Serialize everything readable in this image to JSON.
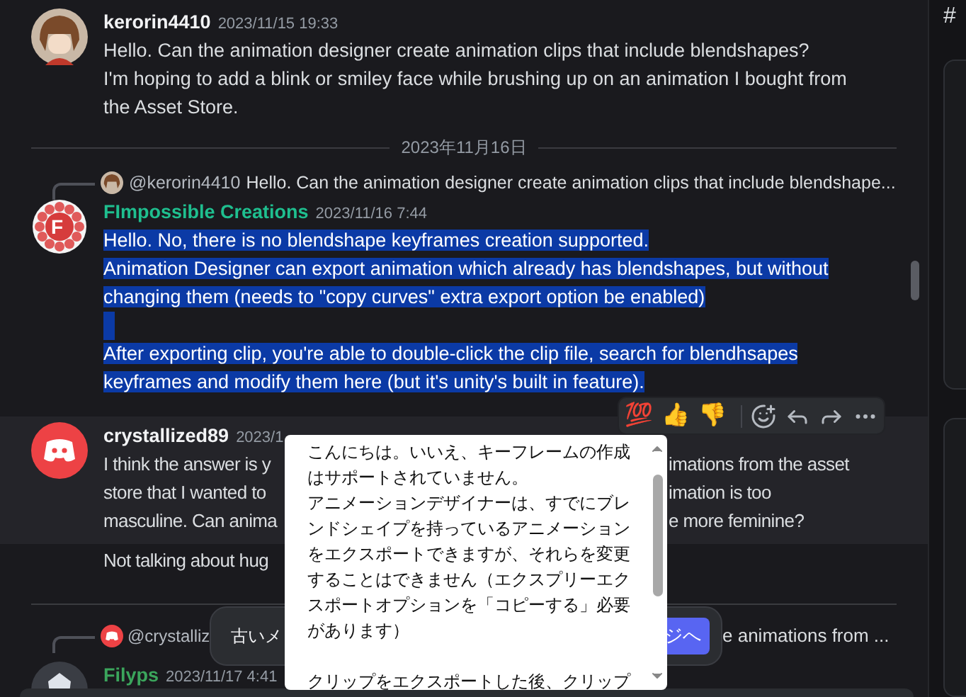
{
  "sidebar": {
    "channel_glyph": "#"
  },
  "messages": [
    {
      "kind": "plain",
      "avatar": {
        "kind": "character"
      },
      "author": {
        "name": "kerorin4410",
        "color": "#f2f3f5"
      },
      "timestamp": "2023/11/15 19:33",
      "paragraphs": [
        {
          "text": "Hello. Can the animation designer create animation clips that include blendshapes?"
        },
        {
          "text": "I'm hoping to add a blink or smiley face while brushing up on an animation I bought from the Asset Store."
        }
      ]
    },
    {
      "kind": "divider",
      "label": "2023年11月16日"
    },
    {
      "kind": "plain",
      "avatar": {
        "kind": "gear",
        "letter": "F"
      },
      "author": {
        "name": "FImpossible Creations",
        "color": "#1fbf8f"
      },
      "timestamp": "2023/11/16 7:44",
      "highlighted": true,
      "reply": {
        "mention": "@kerorin4410",
        "text": "Hello. Can the animation designer create animation clips that include blendshape..."
      },
      "paragraphs": [
        {
          "text": "Hello. No, there is no blendshape keyframes creation supported."
        },
        {
          "text": "Animation Designer can export animation which already has blendshapes, but without changing them (needs to \"copy curves\" extra export option be enabled)"
        },
        {
          "text": "After exporting clip, you're able to double-click the clip file, search for blendhsapes keyframes and modify them here (but it's unity's built in feature).",
          "blank_line_before": true
        }
      ]
    },
    {
      "kind": "covered",
      "avatar": {
        "kind": "discord"
      },
      "author": {
        "name": "crystallized89",
        "color": "#f2f3f5"
      },
      "timestamp": "2023/1",
      "hovered": true,
      "lines": [
        {
          "left": "I think the answer is y",
          "right": "imations from the asset"
        },
        {
          "left": "store that I wanted to",
          "right": "imation is too"
        },
        {
          "left": "masculine. Can anima",
          "right": "e more feminine?"
        }
      ],
      "after": {
        "left": "Not talking about hug"
      }
    },
    {
      "kind": "divider"
    },
    {
      "kind": "partial",
      "avatar": {
        "kind": "dark"
      },
      "author": {
        "name": "Filyps",
        "color": "#3ba55c"
      },
      "timestamp": "2023/11/17 4:41",
      "reply": {
        "mention": "@crystalliz",
        "text": "e animations from ..."
      }
    }
  ],
  "toolbar": {
    "reactions": [
      "💯",
      "👍",
      "👎"
    ]
  },
  "toast": {
    "text": "古いメ",
    "button": "ジへ"
  },
  "translation_popup": {
    "paragraphs": [
      {
        "text": "こんにちは。いいえ、キーフレームの作成はサポートされていません。"
      },
      {
        "text": "アニメーションデザイナーは、すでにブレンドシェイプを持っているアニメーションをエクスポートできますが、それらを変更することはできません（エクスプリーエクスポートオプションを「コピーする」必要があります）"
      },
      {
        "text": "クリップをエクスポートした後、クリップ",
        "blank_line_before": true
      }
    ]
  }
}
